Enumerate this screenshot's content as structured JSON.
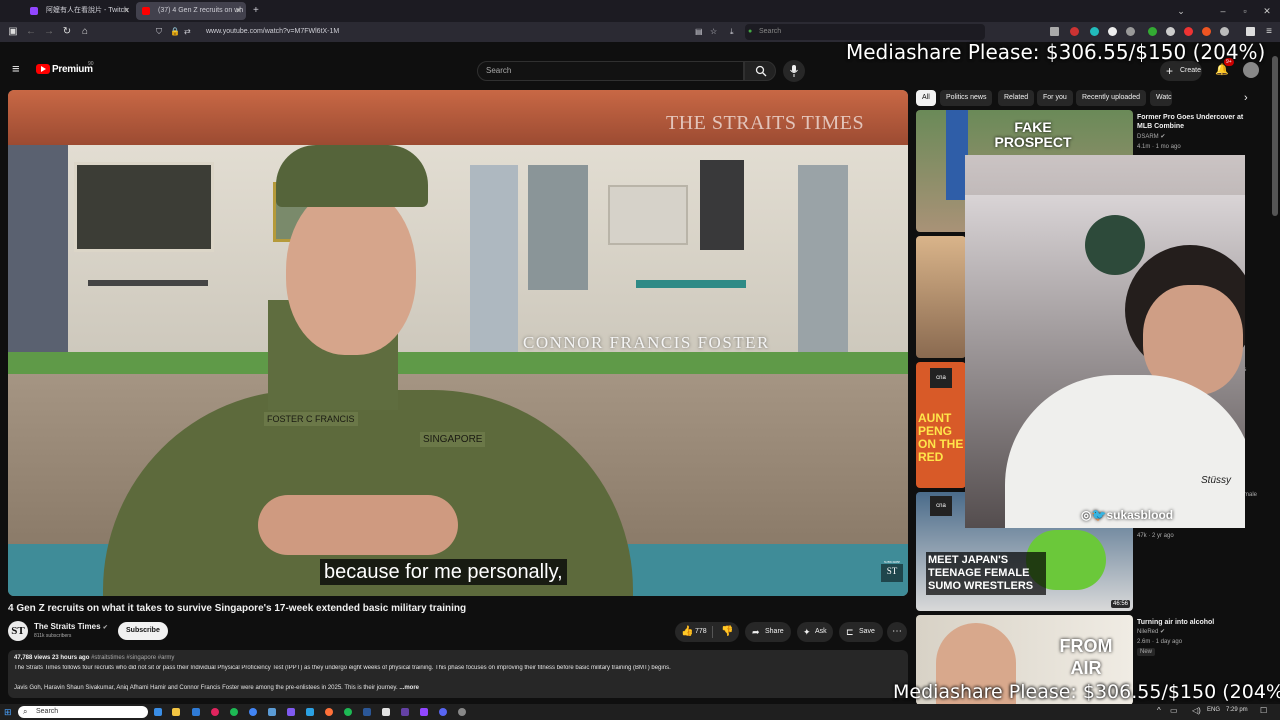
{
  "browser": {
    "tabs": [
      {
        "label": "阿嬤有人在看說片 - Twitch",
        "active": false
      },
      {
        "label": "(37) 4 Gen Z recruits on wh",
        "active": true
      }
    ],
    "new_tab": "+",
    "url": "www.youtube.com/watch?v=M7FWl6tX-1M",
    "search_placeholder": "Search"
  },
  "youtube": {
    "logo": "Premium",
    "logo_badge": "90",
    "search_placeholder": "Search",
    "create_label": "Create",
    "notif_count": "9+"
  },
  "video": {
    "watermark": "THE STRAITS TIMES",
    "lower_third": "CONNOR FRANCIS FOSTER",
    "nametag": "FOSTER C FRANCIS",
    "shoulder_tag": "SINGAPORE",
    "subtitle": "because for me personally,",
    "corner_logo": "ST",
    "subscribe_badge": "SUBSCRIBE"
  },
  "below": {
    "title": "4 Gen Z recruits on what it takes to survive Singapore's 17-week extended basic military training",
    "channel": "The Straits Times",
    "subscribers": "811k subscribers",
    "subscribe": "Subscribe",
    "likes": "778",
    "share": "Share",
    "ask": "Ask",
    "save": "Save",
    "views": "47,788 views",
    "ago": "23 hours ago",
    "tags": "#straitstimes #singapore #army",
    "desc1": "The Straits Times follows four recruits who did not sit or pass their Individual Physical Proficiency Test (IPPT) as they undergo eight weeks of physical training. This phase focuses on improving their fitness before basic military training (BMT) begins.",
    "desc2": "Javis Goh, Haravin Shaun Sivakumar, Aniq Afhami Hamir and Connor Francis Foster were among the pre-enlistees in 2025. This is their journey.",
    "more": "...more"
  },
  "chips": [
    "All",
    "Politics news",
    "Related",
    "For you",
    "Recently uploaded",
    "Watc"
  ],
  "sidebar": [
    {
      "thumb_text": "FAKE PROSPECT",
      "title": "Former Pro Goes Undercover at MLB Combine",
      "channel": "DSARM",
      "meta": "4.1m · 1 mo ago"
    },
    {
      "thumb_text": "AUNT PENG ON THE RED",
      "title": "",
      "channel": "",
      "meta": ""
    },
    {
      "thumb_text": "MEET JAPAN'S TEENAGE FEMALE SUMO WRESTLERS",
      "title": "",
      "channel": "",
      "meta": "47k · 2 yr ago",
      "duration": "46:56"
    },
    {
      "thumb_text": "FROM AIR",
      "title": "Turning air into alcohol",
      "channel": "NileRed",
      "meta": "2.6m · 1 day ago",
      "badge": "New"
    }
  ],
  "side_fragments": {
    "a": "as",
    "b": "male"
  },
  "cna_label": "cna",
  "webcam": {
    "handle": "sukasblood",
    "shirt_text": "Stüssy"
  },
  "overlay": {
    "mediashare_top": "Mediashare Please: $306.55/$150 (204%)",
    "mediashare_bottom": "Mediashare Please: $306.55/$150 (204%)"
  },
  "taskbar": {
    "search": "Search",
    "lang": "ENG",
    "time": "7:29 pm"
  },
  "colors": {
    "youtube_red": "#ff0000",
    "bg": "#0f0f0f",
    "chip": "#272727"
  }
}
